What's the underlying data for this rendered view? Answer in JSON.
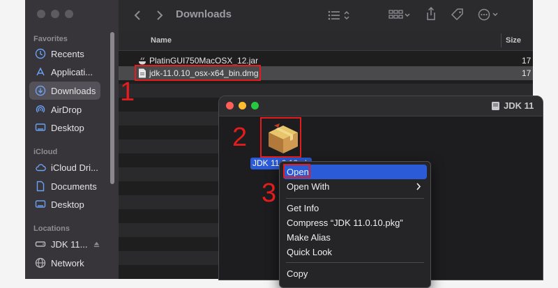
{
  "sidebar": {
    "favorites_label": "Favorites",
    "favorites": [
      {
        "label": "Recents",
        "icon": "clock-icon"
      },
      {
        "label": "Applicati...",
        "icon": "applications-icon"
      },
      {
        "label": "Downloads",
        "icon": "download-icon",
        "selected": true
      },
      {
        "label": "AirDrop",
        "icon": "airdrop-icon"
      },
      {
        "label": "Desktop",
        "icon": "desktop-icon"
      }
    ],
    "icloud_label": "iCloud",
    "icloud": [
      {
        "label": "iCloud Dri...",
        "icon": "cloud-icon"
      },
      {
        "label": "Documents",
        "icon": "document-icon"
      },
      {
        "label": "Desktop",
        "icon": "desktop-icon"
      }
    ],
    "locations_label": "Locations",
    "locations": [
      {
        "label": "JDK 11...",
        "icon": "disk-icon"
      },
      {
        "label": "Network",
        "icon": "network-icon"
      }
    ]
  },
  "toolbar": {
    "title": "Downloads"
  },
  "columns": {
    "name": "Name",
    "size": "Size"
  },
  "files": [
    {
      "name": "PlatinGUI750MacOSX_12.jar",
      "size": "17"
    },
    {
      "name": "jdk-11.0.10_osx-x64_bin.dmg",
      "size": "17"
    }
  ],
  "dmg_window": {
    "title": "JDK 11",
    "package_label": "JDK 11.0.10.pkg"
  },
  "context_menu": {
    "items": [
      {
        "label": "Open"
      },
      {
        "label": "Open With"
      },
      {
        "label": "Get Info"
      },
      {
        "label": "Compress “JDK 11.0.10.pkg”"
      },
      {
        "label": "Make Alias"
      },
      {
        "label": "Quick Look"
      },
      {
        "label": "Copy"
      }
    ]
  },
  "annotations": {
    "step1": "1",
    "step2": "2",
    "step3": "3",
    "color": "#e31d1d"
  },
  "colors": {
    "accent": "#2b5bd7",
    "sidebar_bg": "#373539",
    "window_bg": "#1e1e1e"
  }
}
